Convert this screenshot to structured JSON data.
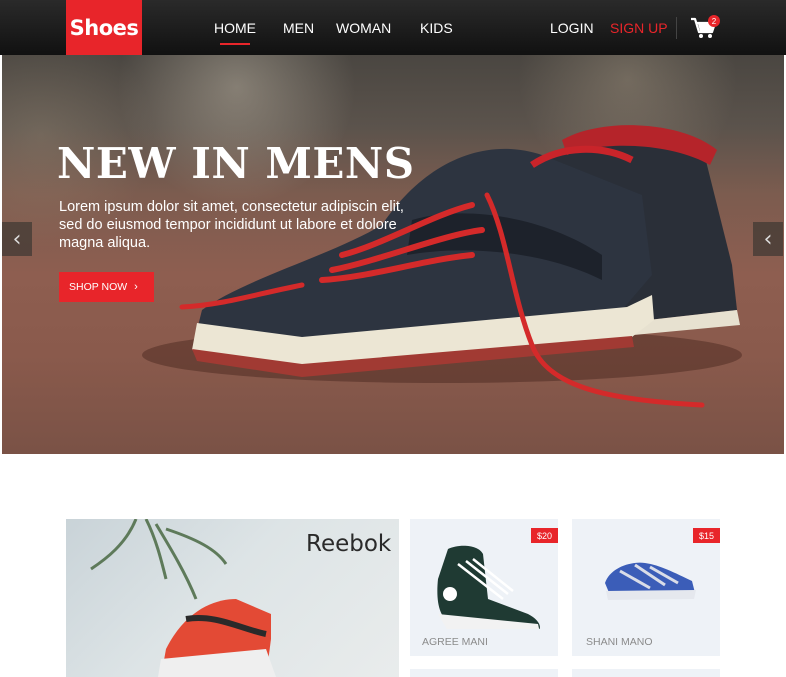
{
  "brand": {
    "logo": "Shoes"
  },
  "nav": {
    "items": [
      {
        "label": "HOME",
        "active": true
      },
      {
        "label": "MEN"
      },
      {
        "label": "WOMAN"
      },
      {
        "label": "KIDS"
      }
    ],
    "login": "LOGIN",
    "signup": "SIGN UP",
    "cart_count": "2"
  },
  "hero": {
    "title": "NEW IN MENS",
    "text": "Lorem ipsum dolor sit amet, consectetur adipiscin  elit, sed do eiusmod tempor incididunt ut labore et dolore magna aliqua.",
    "cta": "SHOP NOW",
    "prev_icon": "chevron-left-icon",
    "next_icon": "chevron-left-icon"
  },
  "featured": {
    "brand": "Reebok"
  },
  "products": [
    {
      "name": "AGREE MANI",
      "price": "$20"
    },
    {
      "name": "SHANI MANO",
      "price": "$15"
    }
  ],
  "colors": {
    "accent": "#e8252a",
    "nav_bg": "#1a1a1a"
  }
}
